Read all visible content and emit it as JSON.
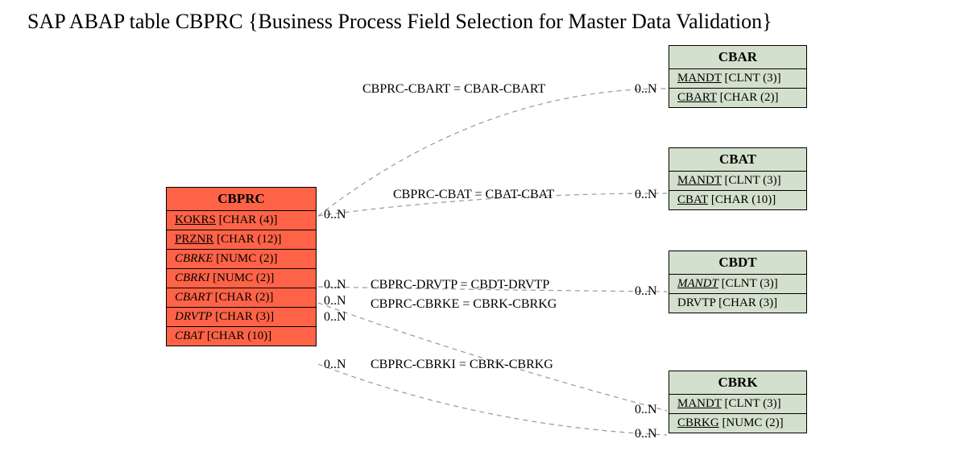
{
  "title": "SAP ABAP table CBPRC {Business Process Field Selection for Master Data Validation}",
  "main": {
    "name": "CBPRC",
    "fields": [
      {
        "name": "KOKRS",
        "type": "[CHAR (4)]",
        "key": true,
        "italic": false
      },
      {
        "name": "PRZNR",
        "type": "[CHAR (12)]",
        "key": true,
        "italic": false
      },
      {
        "name": "CBRKE",
        "type": "[NUMC (2)]",
        "key": false,
        "italic": true
      },
      {
        "name": "CBRKI",
        "type": "[NUMC (2)]",
        "key": false,
        "italic": true
      },
      {
        "name": "CBART",
        "type": "[CHAR (2)]",
        "key": false,
        "italic": true
      },
      {
        "name": "DRVTP",
        "type": "[CHAR (3)]",
        "key": false,
        "italic": true
      },
      {
        "name": "CBAT",
        "type": "[CHAR (10)]",
        "key": false,
        "italic": true
      }
    ]
  },
  "refs": {
    "cbar": {
      "name": "CBAR",
      "fields": [
        {
          "name": "MANDT",
          "type": "[CLNT (3)]",
          "key": true,
          "italic": false
        },
        {
          "name": "CBART",
          "type": "[CHAR (2)]",
          "key": true,
          "italic": false
        }
      ]
    },
    "cbat": {
      "name": "CBAT",
      "fields": [
        {
          "name": "MANDT",
          "type": "[CLNT (3)]",
          "key": true,
          "italic": false
        },
        {
          "name": "CBAT",
          "type": "[CHAR (10)]",
          "key": true,
          "italic": false
        }
      ]
    },
    "cbdt": {
      "name": "CBDT",
      "fields": [
        {
          "name": "MANDT",
          "type": "[CLNT (3)]",
          "key": true,
          "italic": true
        },
        {
          "name": "DRVTP",
          "type": "[CHAR (3)]",
          "key": false,
          "italic": false
        }
      ]
    },
    "cbrk": {
      "name": "CBRK",
      "fields": [
        {
          "name": "MANDT",
          "type": "[CLNT (3)]",
          "key": true,
          "italic": false
        },
        {
          "name": "CBRKG",
          "type": "[NUMC (2)]",
          "key": true,
          "italic": false
        }
      ]
    }
  },
  "rel_labels": {
    "r1": "CBPRC-CBART = CBAR-CBART",
    "r2": "CBPRC-CBAT = CBAT-CBAT",
    "r3": "CBPRC-DRVTP = CBDT-DRVTP",
    "r4": "CBPRC-CBRKE = CBRK-CBRKG",
    "r5": "CBPRC-CBRKI = CBRK-CBRKG"
  },
  "card": {
    "c1l": "0..N",
    "c1r": "0..N",
    "c2r": "0..N",
    "c3l": "0..N",
    "c3r": "0..N",
    "c4l": "0..N",
    "c5l": "0..N",
    "c5r": "0..N",
    "c6r": "0..N"
  }
}
